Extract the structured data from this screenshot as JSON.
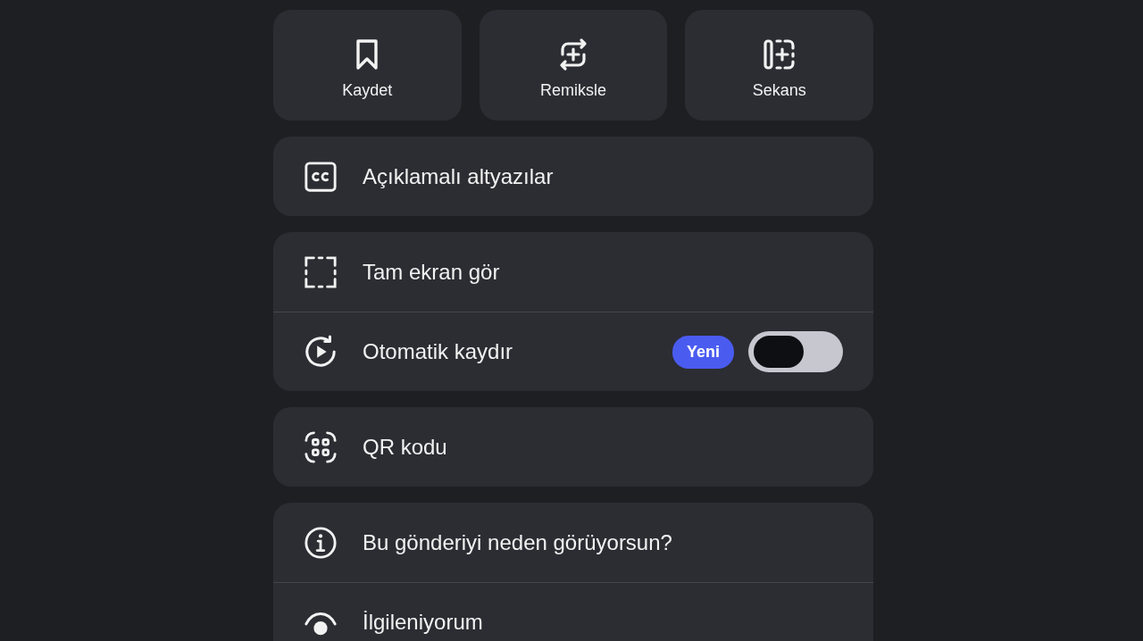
{
  "actions": [
    {
      "label": "Kaydet"
    },
    {
      "label": "Remiksle"
    },
    {
      "label": "Sekans"
    }
  ],
  "groups": [
    {
      "rows": [
        {
          "kind": "plain",
          "label": "Açıklamalı altyazılar"
        }
      ]
    },
    {
      "rows": [
        {
          "kind": "plain",
          "label": "Tam ekran gör"
        },
        {
          "kind": "toggle",
          "label": "Otomatik kaydır",
          "badge": "Yeni",
          "on": false
        }
      ]
    },
    {
      "rows": [
        {
          "kind": "plain",
          "label": "QR kodu"
        }
      ]
    },
    {
      "rows": [
        {
          "kind": "plain",
          "label": "Bu gönderiyi neden görüyorsun?"
        },
        {
          "kind": "plain",
          "label": "İlgileniyorum"
        }
      ]
    }
  ]
}
